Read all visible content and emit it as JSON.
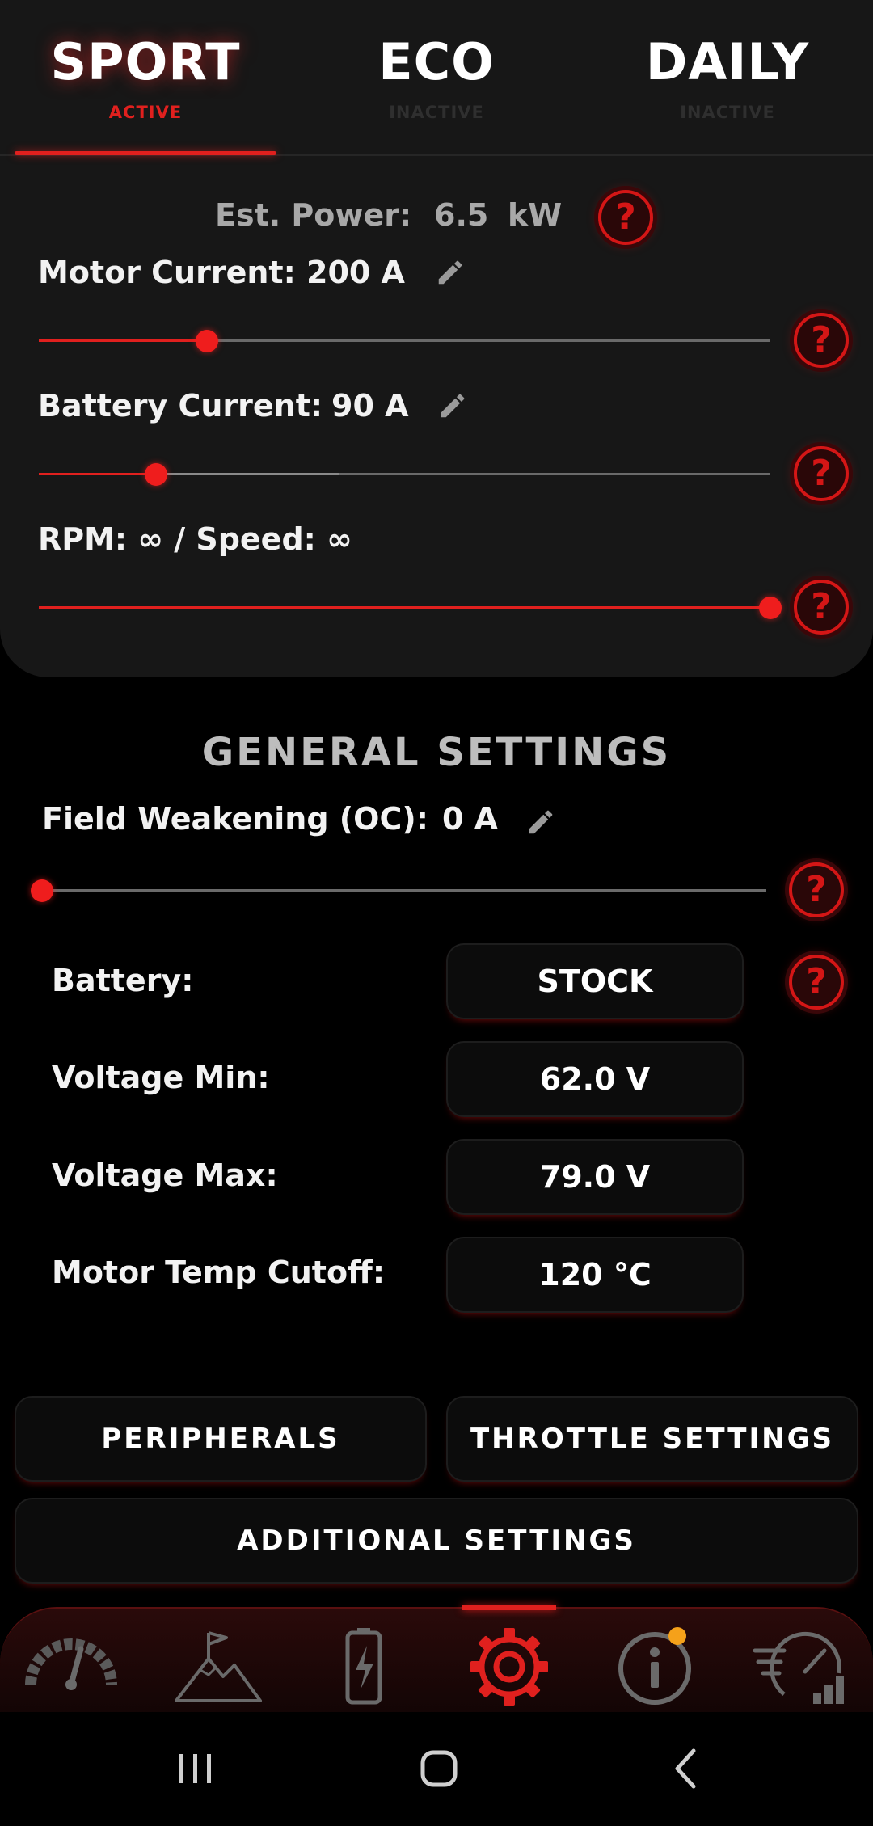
{
  "modes": [
    {
      "name": "SPORT",
      "state": "ACTIVE"
    },
    {
      "name": "ECO",
      "state": "INACTIVE"
    },
    {
      "name": "DAILY",
      "state": "INACTIVE"
    }
  ],
  "power": {
    "label": "Est. Power:",
    "value": "6.5",
    "unit": "kW"
  },
  "motor_current": {
    "label": "Motor Current:",
    "value": "200 A",
    "slider_fraction": 0.23
  },
  "battery_current": {
    "label": "Battery Current:",
    "value": "90 A",
    "slider_fraction": 0.16,
    "secondary_fraction": 0.41
  },
  "rpm_speed": {
    "label": "RPM: ∞ / Speed: ∞",
    "slider_fraction": 1.0
  },
  "general": {
    "title": "GENERAL SETTINGS",
    "field_weakening": {
      "label": "Field Weakening (OC):",
      "value": "0 A",
      "slider_fraction": 0.0
    },
    "rows": [
      {
        "label": "Battery:",
        "value": "STOCK"
      },
      {
        "label": "Voltage Min:",
        "value": "62.0 V"
      },
      {
        "label": "Voltage Max:",
        "value": "79.0 V"
      },
      {
        "label": "Motor Temp Cutoff:",
        "value": "120 °C"
      }
    ],
    "buttons": {
      "peripherals": "PERIPHERALS",
      "throttle": "THROTTLE SETTINGS",
      "additional": "ADDITIONAL SETTINGS"
    }
  },
  "help_glyph": "?",
  "nav": [
    "speedometer-icon",
    "mountain-flag-icon",
    "battery-charging-icon",
    "gear-icon",
    "info-icon",
    "speed-stats-icon"
  ],
  "colors": {
    "accent": "#e0201e",
    "notification": "#f5a11a"
  }
}
